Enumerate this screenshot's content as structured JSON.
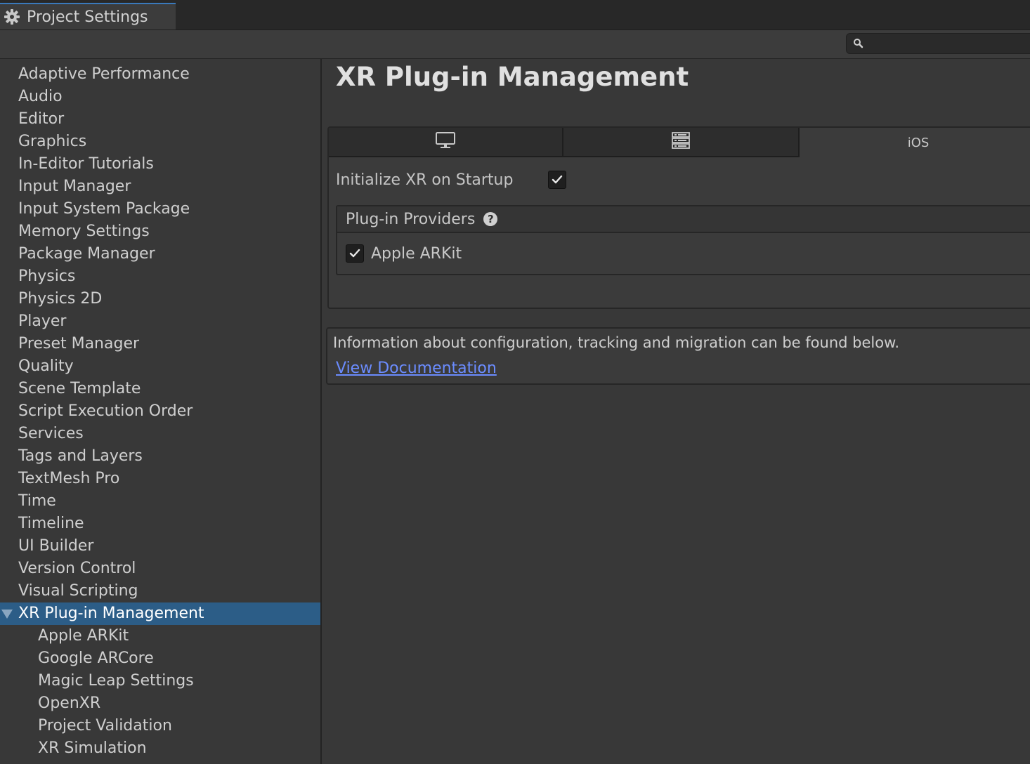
{
  "window": {
    "tab_title": "Project Settings",
    "tab_icon": "gear-icon"
  },
  "search": {
    "placeholder": "",
    "value": ""
  },
  "sidebar": {
    "items": [
      {
        "label": "Adaptive Performance"
      },
      {
        "label": "Audio"
      },
      {
        "label": "Editor"
      },
      {
        "label": "Graphics"
      },
      {
        "label": "In-Editor Tutorials"
      },
      {
        "label": "Input Manager"
      },
      {
        "label": "Input System Package"
      },
      {
        "label": "Memory Settings"
      },
      {
        "label": "Package Manager"
      },
      {
        "label": "Physics"
      },
      {
        "label": "Physics 2D"
      },
      {
        "label": "Player"
      },
      {
        "label": "Preset Manager"
      },
      {
        "label": "Quality"
      },
      {
        "label": "Scene Template"
      },
      {
        "label": "Script Execution Order"
      },
      {
        "label": "Services"
      },
      {
        "label": "Tags and Layers"
      },
      {
        "label": "TextMesh Pro"
      },
      {
        "label": "Time"
      },
      {
        "label": "Timeline"
      },
      {
        "label": "UI Builder"
      },
      {
        "label": "Version Control"
      },
      {
        "label": "Visual Scripting"
      },
      {
        "label": "XR Plug-in Management",
        "selected": true,
        "expanded": true
      },
      {
        "label": "Apple ARKit",
        "child": true
      },
      {
        "label": "Google ARCore",
        "child": true
      },
      {
        "label": "Magic Leap Settings",
        "child": true
      },
      {
        "label": "OpenXR",
        "child": true
      },
      {
        "label": "Project Validation",
        "child": true
      },
      {
        "label": "XR Simulation",
        "child": true
      }
    ]
  },
  "main": {
    "title": "XR Plug-in Management",
    "platform_tabs": [
      {
        "icon": "desktop-monitor-icon",
        "label": ""
      },
      {
        "icon": "server-rack-icon",
        "label": ""
      },
      {
        "icon": "",
        "label": "iOS",
        "active": true
      }
    ],
    "init_label": "Initialize XR on Startup",
    "init_checked": true,
    "providers_title": "Plug-in Providers",
    "help_glyph": "?",
    "providers": [
      {
        "label": "Apple ARKit",
        "checked": true
      }
    ],
    "info_text": "Information about configuration, tracking and migration can be found below.",
    "doc_link": "View Documentation"
  },
  "colors": {
    "background": "#383838",
    "selection": "#2c5d87",
    "link": "#6b8cff",
    "accent_tab_line": "#3a79bb"
  }
}
